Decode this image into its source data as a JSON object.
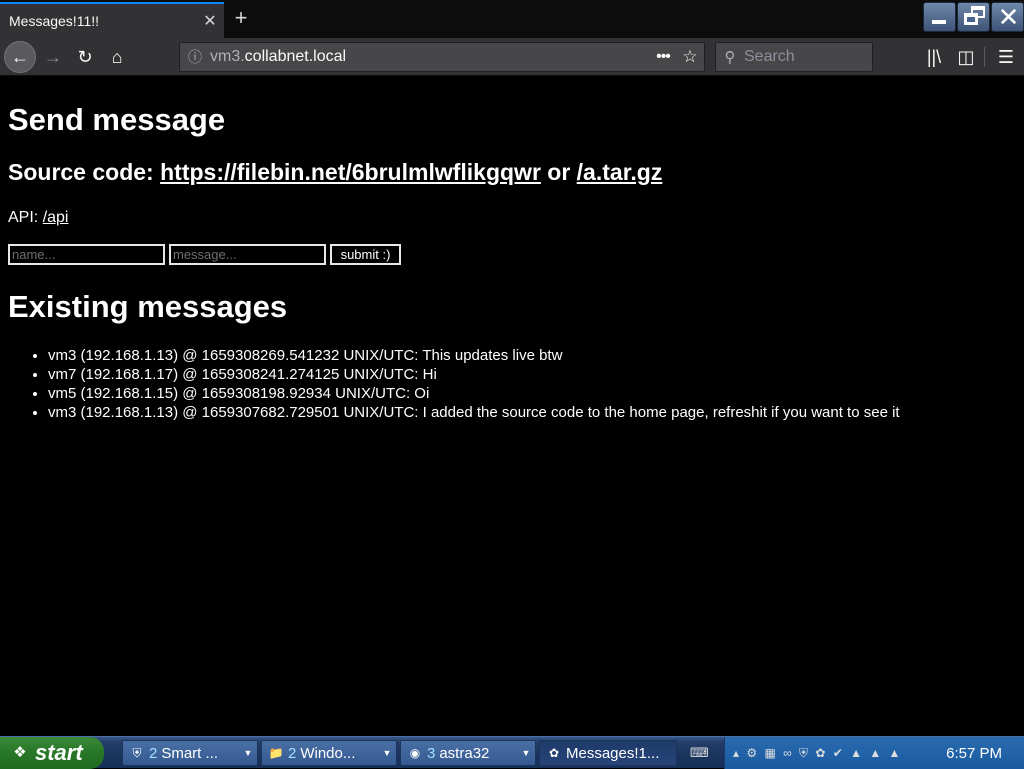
{
  "browser": {
    "tab_title": "Messages!11!!",
    "tab_close": "✕",
    "new_tab": "+",
    "url_prefix": "vm3.",
    "url_host": "collabnet.local",
    "search_placeholder": "Search",
    "page_actions": "•••",
    "icons": [
      "back-icon",
      "forward-icon",
      "reload-icon",
      "home-icon",
      "info-icon",
      "bookmark-star-icon",
      "search-icon",
      "library-icon",
      "sidebar-icon",
      "menu-icon"
    ]
  },
  "window": {
    "close_glyph": "✕"
  },
  "page": {
    "heading_send": "Send message",
    "source_label": "Source code:",
    "source_link": "https://filebin.net/6brulmlwflikgqwr",
    "source_or": "or",
    "source_tar": "/a.tar.gz",
    "api_label": "API:",
    "api_link": "/api",
    "name_placeholder": "name...",
    "message_placeholder": "message...",
    "submit_label": "submit :)",
    "heading_existing": "Existing messages",
    "messages": [
      "vm3 (192.168.1.13) @ 1659308269.541232 UNIX/UTC: This updates live btw",
      "vm7 (192.168.1.17) @ 1659308241.274125 UNIX/UTC: Hi",
      "vm5 (192.168.1.15) @ 1659308198.92934 UNIX/UTC: Oi",
      "vm3 (192.168.1.13) @ 1659307682.729501 UNIX/UTC: I added the source code to the home page, refreshit if you want to see it"
    ]
  },
  "taskbar": {
    "start_label": "start",
    "tasks": [
      {
        "count": "2",
        "label": "Smart ...",
        "icon": "shield-icon"
      },
      {
        "count": "2",
        "label": "Windo...",
        "icon": "folder-icon"
      },
      {
        "count": "3",
        "label": "astra32",
        "icon": "app-icon"
      },
      {
        "count": "",
        "label": "Messages!1...",
        "icon": "firefox-icon"
      }
    ],
    "clock": "6:57 PM",
    "accent": "#245DDA"
  }
}
